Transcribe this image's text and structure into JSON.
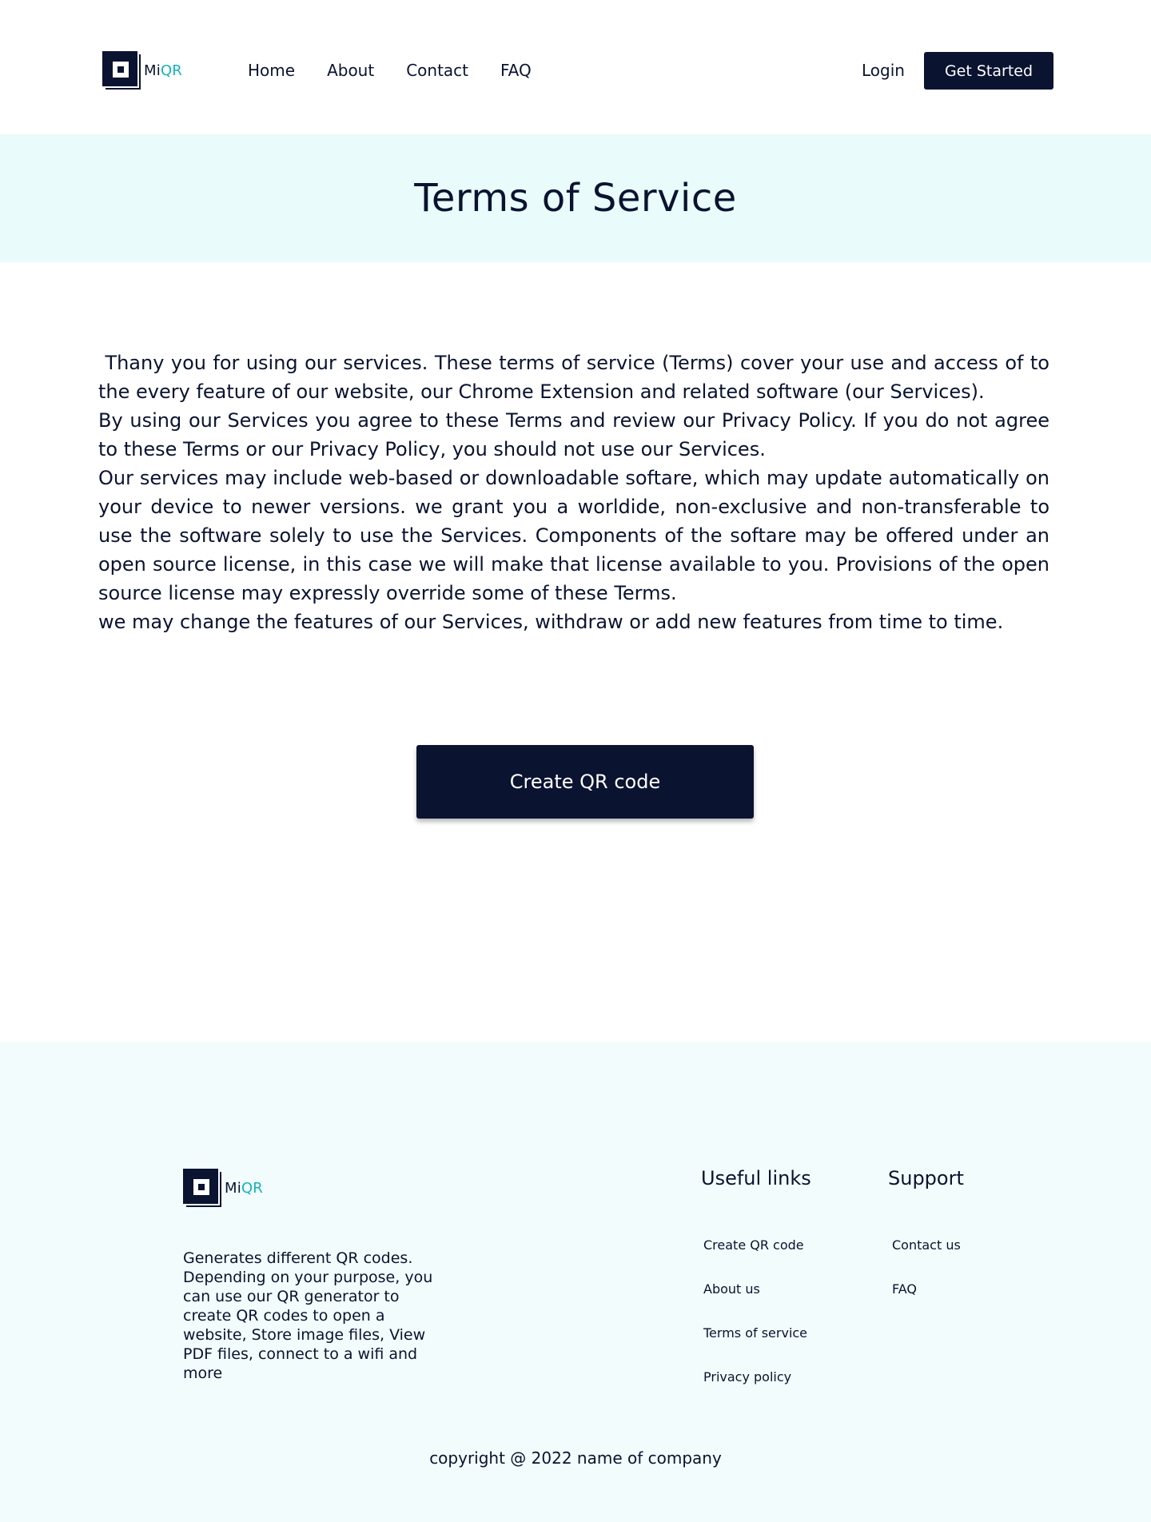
{
  "brand": {
    "name_prefix": "Mi",
    "name_suffix": "QR",
    "accent_color": "#14b3b9",
    "primary_color": "#0a1330"
  },
  "nav": {
    "items": [
      "Home",
      "About",
      "Contact",
      "FAQ"
    ]
  },
  "header": {
    "login_label": "Login",
    "cta_label": "Get Started"
  },
  "banner": {
    "title": "Terms of Service",
    "background": "#e9fbfb"
  },
  "content": {
    "paragraphs": [
      " Thany you for using our services. These terms of service (Terms) cover your use and access of to the every feature of our website, our Chrome Extension and related software (our Services).",
      "By using our Services you agree to these Terms and review our Privacy Policy. If you do not agree to these Terms or our Privacy Policy, you should not use our Services.",
      "Our services may include web-based or downloadable softare, which may update automatically on your device to newer versions. we grant you a worldide, non-exclusive and non-transferable to use the software solely to use the Services. Components of the softare may be offered under an open source license, in this case we will make that license available to you. Provisions of the open source license may expressly override some of these Terms.",
      "we may change the features of our Services, withdraw or add new features from time to time."
    ]
  },
  "cta": {
    "label": "Create QR code"
  },
  "footer": {
    "description": "Generates different QR codes. Depending on your purpose, you can use our  QR generator to create QR codes to open a website, Store image files, View PDF files, connect to a wifi and more",
    "useful_links": {
      "title": "Useful links",
      "items": [
        "Create QR code",
        "About us",
        "Terms of service",
        "Privacy policy"
      ]
    },
    "support": {
      "title": "Support",
      "items": [
        "Contact us",
        "FAQ"
      ]
    },
    "copyright": "copyright @ 2022 name of company"
  }
}
